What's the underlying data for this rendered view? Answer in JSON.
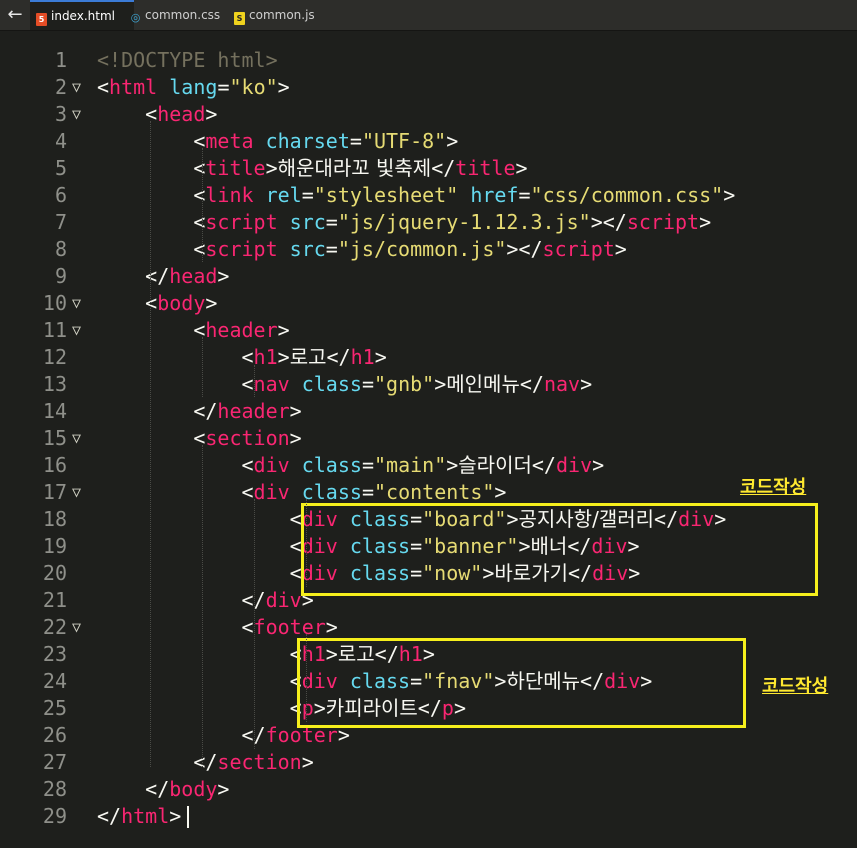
{
  "tabs": {
    "back_label": "←",
    "items": [
      {
        "icon": "html5-file-icon",
        "label": "index.html",
        "active": true
      },
      {
        "icon": "css3-file-icon",
        "label": "common.css",
        "active": false
      },
      {
        "icon": "js-file-icon",
        "label": "common.js",
        "active": false
      }
    ]
  },
  "editor": {
    "lines": [
      {
        "n": "1",
        "fold": "",
        "parts": [
          [
            "doc",
            "<!DOCTYPE html>"
          ]
        ]
      },
      {
        "n": "2",
        "fold": "▽",
        "parts": [
          [
            "p",
            "<"
          ],
          [
            "tag",
            "html"
          ],
          [
            "p",
            " "
          ],
          [
            "attr",
            "lang"
          ],
          [
            "p",
            "="
          ],
          [
            "str",
            "\"ko\""
          ],
          [
            "p",
            ">"
          ]
        ]
      },
      {
        "n": "3",
        "fold": "▽",
        "parts": [
          [
            "p",
            "    <"
          ],
          [
            "tag",
            "head"
          ],
          [
            "p",
            ">"
          ]
        ]
      },
      {
        "n": "4",
        "fold": "",
        "parts": [
          [
            "p",
            "        <"
          ],
          [
            "tag",
            "meta"
          ],
          [
            "p",
            " "
          ],
          [
            "attr",
            "charset"
          ],
          [
            "p",
            "="
          ],
          [
            "str",
            "\"UTF-8\""
          ],
          [
            "p",
            ">"
          ]
        ]
      },
      {
        "n": "5",
        "fold": "",
        "parts": [
          [
            "p",
            "        <"
          ],
          [
            "tag",
            "title"
          ],
          [
            "p",
            ">"
          ],
          [
            "kor",
            "해운대라꼬 빛축제"
          ],
          [
            "p",
            "</"
          ],
          [
            "tag",
            "title"
          ],
          [
            "p",
            ">"
          ]
        ]
      },
      {
        "n": "6",
        "fold": "",
        "parts": [
          [
            "p",
            "        <"
          ],
          [
            "tag",
            "link"
          ],
          [
            "p",
            " "
          ],
          [
            "attr",
            "rel"
          ],
          [
            "p",
            "="
          ],
          [
            "str",
            "\"stylesheet\""
          ],
          [
            "p",
            " "
          ],
          [
            "attr",
            "href"
          ],
          [
            "p",
            "="
          ],
          [
            "str",
            "\"css/common.css\""
          ],
          [
            "p",
            ">"
          ]
        ]
      },
      {
        "n": "7",
        "fold": "",
        "parts": [
          [
            "p",
            "        <"
          ],
          [
            "tag",
            "script"
          ],
          [
            "p",
            " "
          ],
          [
            "attr",
            "src"
          ],
          [
            "p",
            "="
          ],
          [
            "str",
            "\"js/jquery-1.12.3.js\""
          ],
          [
            "p",
            "></"
          ],
          [
            "tag",
            "script"
          ],
          [
            "p",
            ">"
          ]
        ]
      },
      {
        "n": "8",
        "fold": "",
        "parts": [
          [
            "p",
            "        <"
          ],
          [
            "tag",
            "script"
          ],
          [
            "p",
            " "
          ],
          [
            "attr",
            "src"
          ],
          [
            "p",
            "="
          ],
          [
            "str",
            "\"js/common.js\""
          ],
          [
            "p",
            "></"
          ],
          [
            "tag",
            "script"
          ],
          [
            "p",
            ">"
          ]
        ]
      },
      {
        "n": "9",
        "fold": "",
        "parts": [
          [
            "p",
            "    </"
          ],
          [
            "tag",
            "head"
          ],
          [
            "p",
            ">"
          ]
        ]
      },
      {
        "n": "10",
        "fold": "▽",
        "parts": [
          [
            "p",
            "    <"
          ],
          [
            "tag",
            "body"
          ],
          [
            "p",
            ">"
          ]
        ]
      },
      {
        "n": "11",
        "fold": "▽",
        "parts": [
          [
            "p",
            "        <"
          ],
          [
            "tag",
            "header"
          ],
          [
            "p",
            ">"
          ]
        ]
      },
      {
        "n": "12",
        "fold": "",
        "parts": [
          [
            "p",
            "            <"
          ],
          [
            "tag",
            "h1"
          ],
          [
            "p",
            ">"
          ],
          [
            "kor",
            "로고"
          ],
          [
            "p",
            "</"
          ],
          [
            "tag",
            "h1"
          ],
          [
            "p",
            ">"
          ]
        ]
      },
      {
        "n": "13",
        "fold": "",
        "parts": [
          [
            "p",
            "            <"
          ],
          [
            "tag",
            "nav"
          ],
          [
            "p",
            " "
          ],
          [
            "attr",
            "class"
          ],
          [
            "p",
            "="
          ],
          [
            "str",
            "\"gnb\""
          ],
          [
            "p",
            ">"
          ],
          [
            "kor",
            "메인메뉴"
          ],
          [
            "p",
            "</"
          ],
          [
            "tag",
            "nav"
          ],
          [
            "p",
            ">"
          ]
        ]
      },
      {
        "n": "14",
        "fold": "",
        "parts": [
          [
            "p",
            "        </"
          ],
          [
            "tag",
            "header"
          ],
          [
            "p",
            ">"
          ]
        ]
      },
      {
        "n": "15",
        "fold": "▽",
        "parts": [
          [
            "p",
            "        <"
          ],
          [
            "tag",
            "section"
          ],
          [
            "p",
            ">"
          ]
        ]
      },
      {
        "n": "16",
        "fold": "",
        "parts": [
          [
            "p",
            "            <"
          ],
          [
            "tag",
            "div"
          ],
          [
            "p",
            " "
          ],
          [
            "attr",
            "class"
          ],
          [
            "p",
            "="
          ],
          [
            "str",
            "\"main\""
          ],
          [
            "p",
            ">"
          ],
          [
            "kor",
            "슬라이더"
          ],
          [
            "p",
            "</"
          ],
          [
            "tag",
            "div"
          ],
          [
            "p",
            ">"
          ]
        ]
      },
      {
        "n": "17",
        "fold": "▽",
        "parts": [
          [
            "p",
            "            <"
          ],
          [
            "tag",
            "div"
          ],
          [
            "p",
            " "
          ],
          [
            "attr",
            "class"
          ],
          [
            "p",
            "="
          ],
          [
            "str",
            "\"contents\""
          ],
          [
            "p",
            ">"
          ]
        ]
      },
      {
        "n": "18",
        "fold": "",
        "parts": [
          [
            "p",
            "                <"
          ],
          [
            "tag",
            "div"
          ],
          [
            "p",
            " "
          ],
          [
            "attr",
            "class"
          ],
          [
            "p",
            "="
          ],
          [
            "str",
            "\"board\""
          ],
          [
            "p",
            ">"
          ],
          [
            "kor",
            "공지사항/갤러리"
          ],
          [
            "p",
            "</"
          ],
          [
            "tag",
            "div"
          ],
          [
            "p",
            ">"
          ]
        ]
      },
      {
        "n": "19",
        "fold": "",
        "parts": [
          [
            "p",
            "                <"
          ],
          [
            "tag",
            "div"
          ],
          [
            "p",
            " "
          ],
          [
            "attr",
            "class"
          ],
          [
            "p",
            "="
          ],
          [
            "str",
            "\"banner\""
          ],
          [
            "p",
            ">"
          ],
          [
            "kor",
            "배너"
          ],
          [
            "p",
            "</"
          ],
          [
            "tag",
            "div"
          ],
          [
            "p",
            ">"
          ]
        ]
      },
      {
        "n": "20",
        "fold": "",
        "parts": [
          [
            "p",
            "                <"
          ],
          [
            "tag",
            "div"
          ],
          [
            "p",
            " "
          ],
          [
            "attr",
            "class"
          ],
          [
            "p",
            "="
          ],
          [
            "str",
            "\"now\""
          ],
          [
            "p",
            ">"
          ],
          [
            "kor",
            "바로가기"
          ],
          [
            "p",
            "</"
          ],
          [
            "tag",
            "div"
          ],
          [
            "p",
            ">"
          ]
        ]
      },
      {
        "n": "21",
        "fold": "",
        "parts": [
          [
            "p",
            "            </"
          ],
          [
            "tag",
            "div"
          ],
          [
            "p",
            ">"
          ]
        ]
      },
      {
        "n": "22",
        "fold": "▽",
        "parts": [
          [
            "p",
            "            <"
          ],
          [
            "tag",
            "footer"
          ],
          [
            "p",
            ">"
          ]
        ]
      },
      {
        "n": "23",
        "fold": "",
        "parts": [
          [
            "p",
            "                <"
          ],
          [
            "tag",
            "h1"
          ],
          [
            "p",
            ">"
          ],
          [
            "kor",
            "로고"
          ],
          [
            "p",
            "</"
          ],
          [
            "tag",
            "h1"
          ],
          [
            "p",
            ">"
          ]
        ]
      },
      {
        "n": "24",
        "fold": "",
        "parts": [
          [
            "p",
            "                <"
          ],
          [
            "tag",
            "div"
          ],
          [
            "p",
            " "
          ],
          [
            "attr",
            "class"
          ],
          [
            "p",
            "="
          ],
          [
            "str",
            "\"fnav\""
          ],
          [
            "p",
            ">"
          ],
          [
            "kor",
            "하단메뉴"
          ],
          [
            "p",
            "</"
          ],
          [
            "tag",
            "div"
          ],
          [
            "p",
            ">"
          ]
        ]
      },
      {
        "n": "25",
        "fold": "",
        "parts": [
          [
            "p",
            "                <"
          ],
          [
            "tag",
            "p"
          ],
          [
            "p",
            ">"
          ],
          [
            "kor",
            "카피라이트"
          ],
          [
            "p",
            "</"
          ],
          [
            "tag",
            "p"
          ],
          [
            "p",
            ">"
          ]
        ]
      },
      {
        "n": "26",
        "fold": "",
        "parts": [
          [
            "p",
            "            </"
          ],
          [
            "tag",
            "footer"
          ],
          [
            "p",
            ">"
          ]
        ]
      },
      {
        "n": "27",
        "fold": "",
        "parts": [
          [
            "p",
            "        </"
          ],
          [
            "tag",
            "section"
          ],
          [
            "p",
            ">"
          ]
        ]
      },
      {
        "n": "28",
        "fold": "",
        "parts": [
          [
            "p",
            "    </"
          ],
          [
            "tag",
            "body"
          ],
          [
            "p",
            ">"
          ]
        ]
      },
      {
        "n": "29",
        "fold": "",
        "parts": [
          [
            "p",
            "</"
          ],
          [
            "tag",
            "html"
          ],
          [
            "p",
            ">"
          ]
        ]
      }
    ]
  },
  "annotations": {
    "contents_label": "코드작성",
    "footer_label": "코드작성",
    "highlight_color": "#f6ef1c"
  },
  "colors": {
    "background": "#1e1f1c",
    "tag": "#f92672",
    "attribute": "#66d9ef",
    "string": "#e6db74",
    "text": "#f8f8f2",
    "line_number": "#8f908a"
  }
}
